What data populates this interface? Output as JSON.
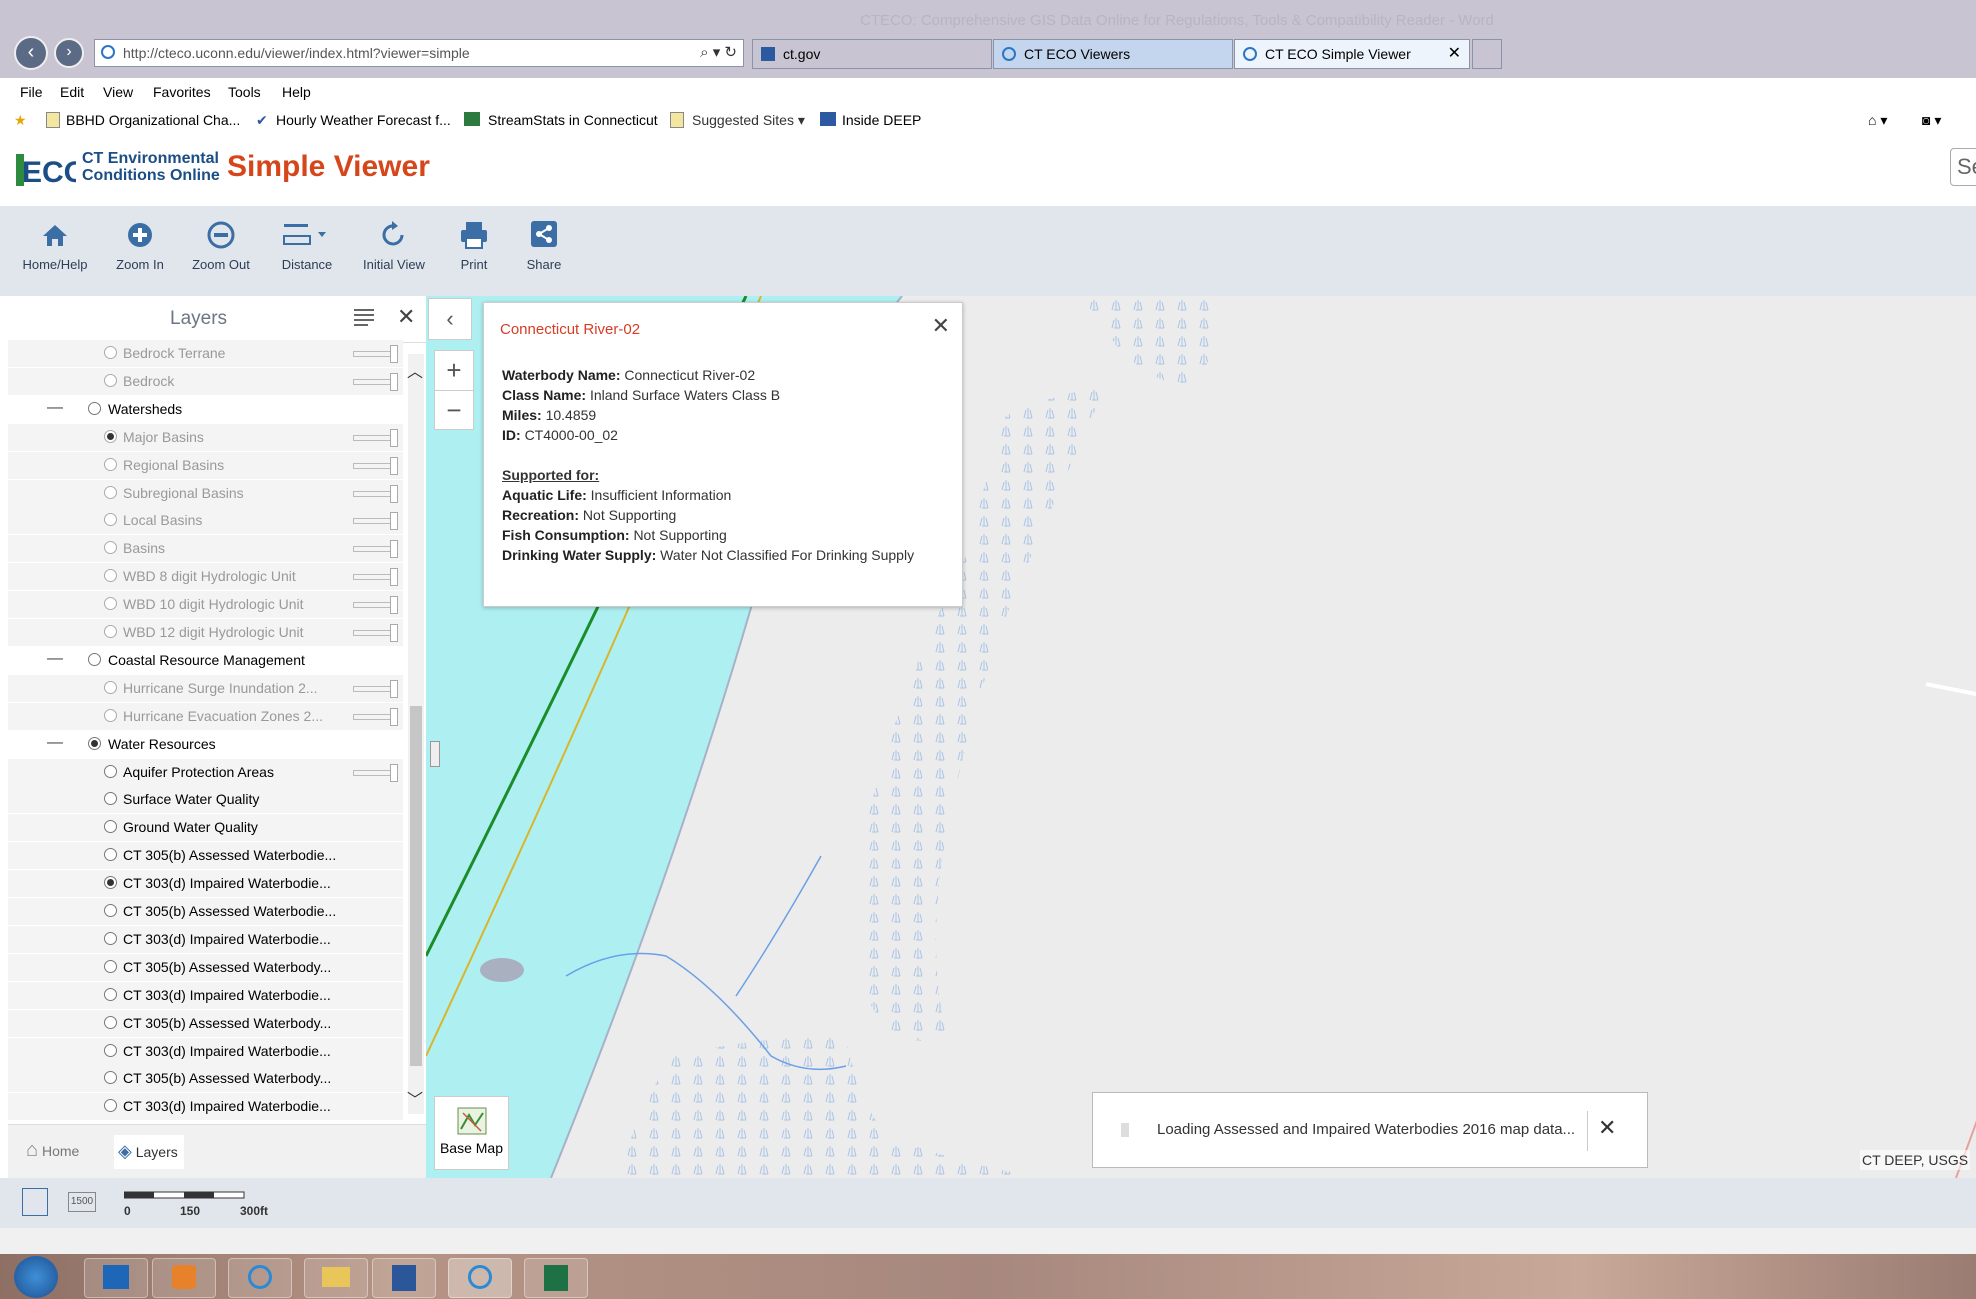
{
  "browser": {
    "window_title": "CTECO: Comprehensive GIS Data Online for Regulations, Tools & Compatibility Reader - Word",
    "address": "http://cteco.uconn.edu/viewer/index.html?viewer=simple",
    "tabs": [
      {
        "label": "ct.gov"
      },
      {
        "label": "CT ECO Viewers"
      },
      {
        "label": "CT ECO Simple Viewer"
      }
    ],
    "menu": [
      "File",
      "Edit",
      "View",
      "Favorites",
      "Tools",
      "Help"
    ],
    "favorites": [
      "BBHD Organizational Cha...",
      "Hourly Weather Forecast f...",
      "StreamStats in Connecticut",
      "Suggested Sites ▾",
      "Inside DEEP"
    ]
  },
  "app": {
    "logo_line1": "CT Environmental",
    "logo_line2": "Conditions Online",
    "title": "Simple Viewer",
    "search_partial": "Se"
  },
  "toolbar": [
    {
      "label": "Home/Help"
    },
    {
      "label": "Zoom In"
    },
    {
      "label": "Zoom Out"
    },
    {
      "label": "Distance"
    },
    {
      "label": "Initial View"
    },
    {
      "label": "Print"
    },
    {
      "label": "Share"
    }
  ],
  "layers_panel": {
    "title": "Layers",
    "rows": [
      {
        "label": "Bedrock Terrane",
        "level": 2,
        "state": "dim"
      },
      {
        "label": "Bedrock",
        "level": 2,
        "state": "dim"
      },
      {
        "label": "Watersheds",
        "level": 1,
        "state": "off",
        "collapse": "—"
      },
      {
        "label": "Major Basins",
        "level": 2,
        "state": "dim-on"
      },
      {
        "label": "Regional Basins",
        "level": 2,
        "state": "dim"
      },
      {
        "label": "Subregional Basins",
        "level": 2,
        "state": "dim"
      },
      {
        "label": "Local Basins",
        "level": 2,
        "state": "dim"
      },
      {
        "label": "Basins",
        "level": 2,
        "state": "dim"
      },
      {
        "label": "WBD 8 digit Hydrologic Unit",
        "level": 2,
        "state": "dim"
      },
      {
        "label": "WBD 10 digit Hydrologic Unit",
        "level": 2,
        "state": "dim"
      },
      {
        "label": "WBD 12 digit Hydrologic Unit",
        "level": 2,
        "state": "dim"
      },
      {
        "label": "Coastal Resource Management",
        "level": 1,
        "state": "off",
        "collapse": "—"
      },
      {
        "label": "Hurricane Surge Inundation 2...",
        "level": 2,
        "state": "dim"
      },
      {
        "label": "Hurricane Evacuation Zones 2...",
        "level": 2,
        "state": "dim"
      },
      {
        "label": "Water Resources",
        "level": 1,
        "state": "on",
        "collapse": "—"
      },
      {
        "label": "Aquifer Protection Areas",
        "level": 2,
        "state": "off",
        "slider": true
      },
      {
        "label": "Surface Water Quality",
        "level": 2,
        "state": "off"
      },
      {
        "label": "Ground Water Quality",
        "level": 2,
        "state": "off"
      },
      {
        "label": "CT 305(b) Assessed Waterbodie...",
        "level": 2,
        "state": "off"
      },
      {
        "label": "CT 303(d) Impaired Waterbodie...",
        "level": 2,
        "state": "on"
      },
      {
        "label": "CT 305(b) Assessed Waterbodie...",
        "level": 2,
        "state": "off"
      },
      {
        "label": "CT 303(d) Impaired Waterbodie...",
        "level": 2,
        "state": "off"
      },
      {
        "label": "CT 305(b) Assessed Waterbody...",
        "level": 2,
        "state": "off"
      },
      {
        "label": "CT 303(d) Impaired Waterbodie...",
        "level": 2,
        "state": "off"
      },
      {
        "label": "CT 305(b) Assessed Waterbody...",
        "level": 2,
        "state": "off"
      },
      {
        "label": "CT 303(d) Impaired Waterbodie...",
        "level": 2,
        "state": "off"
      },
      {
        "label": "CT 305(b) Assessed Waterbody...",
        "level": 2,
        "state": "off"
      },
      {
        "label": "CT 303(d) Impaired Waterbodie...",
        "level": 2,
        "state": "off"
      }
    ],
    "footer_tabs": [
      {
        "label": "Home"
      },
      {
        "label": "Layers"
      }
    ]
  },
  "popup": {
    "title": "Connecticut River-02",
    "fields": [
      {
        "name": "Waterbody Name:",
        "value": "Connecticut River-02"
      },
      {
        "name": "Class Name:",
        "value": "Inland Surface Waters Class B"
      },
      {
        "name": "Miles:",
        "value": "10.4859"
      },
      {
        "name": "ID:",
        "value": "CT4000-00_02"
      }
    ],
    "supported_heading": "Supported for:",
    "supported": [
      {
        "name": "Aquatic Life:",
        "value": "Insufficient Information"
      },
      {
        "name": "Recreation:",
        "value": "Not Supporting"
      },
      {
        "name": "Fish Consumption:",
        "value": "Not Supporting"
      },
      {
        "name": "Drinking Water Supply:",
        "value": "Water Not Classified For Drinking Supply"
      }
    ]
  },
  "map": {
    "basemap_label": "Base Map",
    "loading_text": "Loading Assessed and Impaired Waterbodies 2016 map data...",
    "attribution": "CT DEEP, USGS",
    "scale_labels": [
      "0",
      "150",
      "300ft"
    ],
    "scale_ratio_label": "1500"
  },
  "colors": {
    "water": "#aef0f2",
    "land": "#ececec",
    "accent_title": "#d6461b",
    "popup_title": "#d73d26"
  }
}
